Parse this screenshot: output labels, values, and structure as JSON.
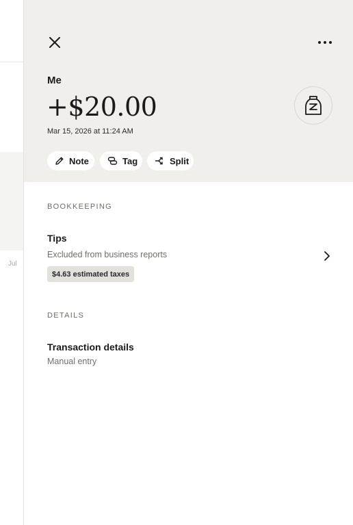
{
  "background": {
    "month_label": "Jul"
  },
  "panel": {
    "payee": "Me",
    "amount": "+$20.00",
    "date": "Mar 15, 2026 at 11:24 AM",
    "actions": [
      {
        "label": "Note",
        "icon": "pencil-icon"
      },
      {
        "label": "Tag",
        "icon": "tag-icon"
      },
      {
        "label": "Split",
        "icon": "split-icon"
      }
    ],
    "merchant_icon": "shopping-bag-icon"
  },
  "bookkeeping": {
    "section_label": "BOOKKEEPING",
    "category": "Tips",
    "description": "Excluded from business reports",
    "tax_badge": "$4.63 estimated taxes"
  },
  "details": {
    "section_label": "DETAILS",
    "title": "Transaction details",
    "subtitle": "Manual entry"
  },
  "colors": {
    "header_bg": "#f0efeb",
    "panel_bg": "#ffffff",
    "badge_bg": "#e2e1dc",
    "text_primary": "#1a1a1a",
    "text_muted": "#6f6f6b"
  }
}
